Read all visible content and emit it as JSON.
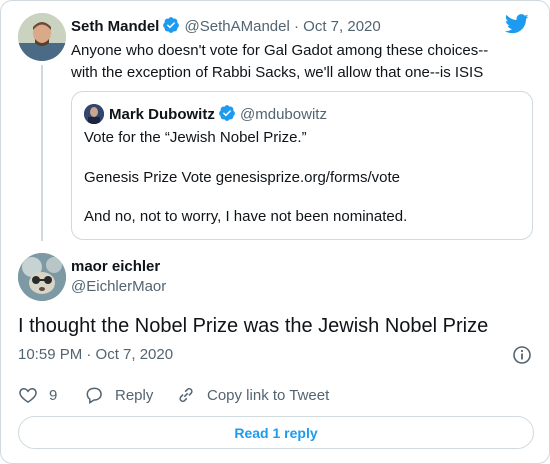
{
  "parent_tweet": {
    "name": "Seth Mandel",
    "handle": "@SethAMandel",
    "separator": "·",
    "date": "Oct 7, 2020",
    "text": "Anyone who doesn't vote for Gal Gadot among these choices--with the exception of Rabbi Sacks, we'll allow that one--is ISIS"
  },
  "quoted_tweet": {
    "name": "Mark Dubowitz",
    "handle": "@mdubowitz",
    "line1": "Vote for the “Jewish Nobel Prize.”",
    "line2": "Genesis Prize Vote genesisprize.org/forms/vote",
    "line3": "And no, not to worry, I have not been nominated."
  },
  "main_tweet": {
    "name": "maor eichler",
    "handle": "@EichlerMaor",
    "text": "I thought the Nobel Prize was the Jewish Nobel Prize",
    "timestamp": "10:59 PM · Oct 7, 2020",
    "likes": "9",
    "reply_label": "Reply",
    "copy_link_label": "Copy link to Tweet",
    "read_replies_label": "Read 1 reply"
  },
  "colors": {
    "accent": "#1d9bf0",
    "muted": "#536471",
    "border": "#cfd9de",
    "text": "#0f1419"
  },
  "icons": [
    "verified-icon",
    "twitter-logo-icon",
    "info-icon",
    "heart-icon",
    "reply-icon",
    "link-icon"
  ]
}
